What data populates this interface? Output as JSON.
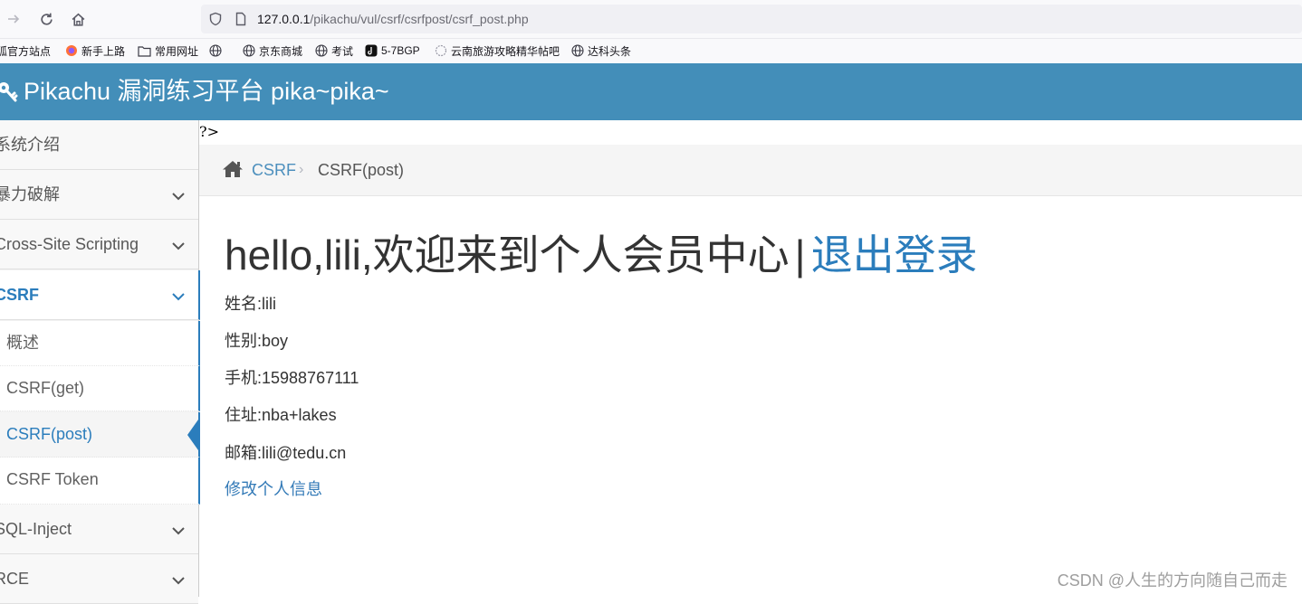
{
  "browser": {
    "url_host": "127.0.0.1",
    "url_path": "/pikachu/vul/csrf/csrfpost/csrf_post.php",
    "bookmarks": [
      {
        "label": "狐官方站点",
        "icon": "fox-icon"
      },
      {
        "label": "新手上路",
        "icon": "firefox-icon"
      },
      {
        "label": "常用网址",
        "icon": "folder-icon"
      },
      {
        "label": "",
        "icon": "globe-icon"
      },
      {
        "label": "京东商城",
        "icon": "globe-icon"
      },
      {
        "label": "考试",
        "icon": "globe-icon"
      },
      {
        "label": "5-7BGP",
        "icon": "tiktok-icon"
      },
      {
        "label": "云南旅游攻略精华帖吧",
        "icon": "tieba-icon"
      },
      {
        "label": "达科头条",
        "icon": "globe-icon"
      }
    ]
  },
  "header": {
    "title": "Pikachu 漏洞练习平台 pika~pika~",
    "color": "#438eb9"
  },
  "sidebar": {
    "items": [
      {
        "label": "系统介绍",
        "expandable": false
      },
      {
        "label": "暴力破解",
        "expandable": true
      },
      {
        "label": "Cross-Site Scripting",
        "expandable": true
      },
      {
        "label": "CSRF",
        "expandable": true,
        "active": true
      },
      {
        "label": "SQL-Inject",
        "expandable": true
      },
      {
        "label": "RCE",
        "expandable": true
      }
    ],
    "csrf_sub": [
      {
        "label": "概述"
      },
      {
        "label": "CSRF(get)"
      },
      {
        "label": "CSRF(post)",
        "active": true
      },
      {
        "label": "CSRF Token"
      }
    ]
  },
  "main": {
    "stray_text": "?>",
    "breadcrumb": {
      "parent": "CSRF",
      "current": "CSRF(post)"
    },
    "welcome": "hello,lili,欢迎来到个人会员中心",
    "separator": "|",
    "logout": "退出登录",
    "info": [
      "姓名:lili",
      "性别:boy",
      "手机:15988767111",
      "住址:nba+lakes",
      "邮箱:lili@tedu.cn"
    ],
    "edit_link": "修改个人信息"
  },
  "watermark": "CSDN @人生的方向随自己而走"
}
